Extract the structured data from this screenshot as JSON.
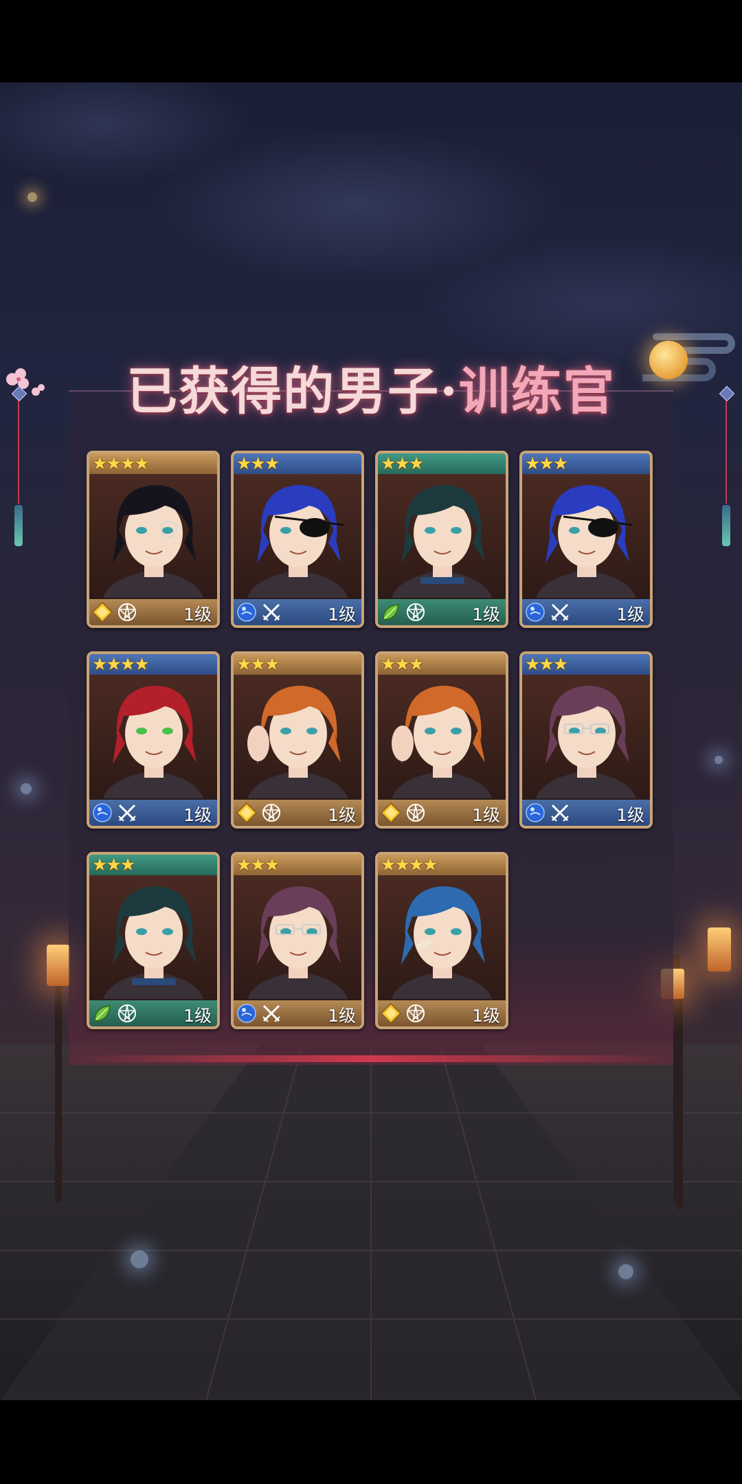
{
  "title": {
    "main": "已获得的男子",
    "separator": "·",
    "accent": "训练官"
  },
  "colors": {
    "frame": "#c9a478",
    "star": "#ffd84a",
    "bar_gold": "#c89a5c",
    "bar_blue": "#4e76b6",
    "bar_green": "#3f9a84"
  },
  "cards": [
    {
      "stars": "★★★★",
      "star_bar": "gold",
      "attribute": "gold-diamond-icon",
      "type": "pentagram-icon",
      "level": "1级",
      "hair": "#15141c",
      "extra": "monocle"
    },
    {
      "stars": "★★★",
      "star_bar": "blue",
      "attribute": "blue-drop-icon",
      "type": "crossed-swords-icon",
      "level": "1级",
      "hair": "#2a3cc0",
      "extra": "eyepatch"
    },
    {
      "stars": "★★★",
      "star_bar": "green",
      "attribute": "green-leaf-icon",
      "type": "pentagram-icon",
      "level": "1级",
      "hair": "#1d3a3e",
      "extra": "choker"
    },
    {
      "stars": "★★★",
      "star_bar": "blue",
      "attribute": "blue-drop-icon",
      "type": "crossed-swords-icon",
      "level": "1级",
      "hair": "#2a3cc0",
      "extra": "eyepatch"
    },
    {
      "stars": "★★★★",
      "star_bar": "blue",
      "attribute": "blue-drop-icon",
      "type": "crossed-swords-icon",
      "level": "1级",
      "hair": "#b3202a",
      "extra": "none"
    },
    {
      "stars": "★★★",
      "star_bar": "gold",
      "attribute": "gold-diamond-icon",
      "type": "pentagram-icon",
      "level": "1级",
      "hair": "#d0692a",
      "extra": "hand"
    },
    {
      "stars": "★★★",
      "star_bar": "gold",
      "attribute": "gold-diamond-icon",
      "type": "pentagram-icon",
      "level": "1级",
      "hair": "#d0692a",
      "extra": "hand"
    },
    {
      "stars": "★★★",
      "star_bar": "blue",
      "attribute": "blue-drop-icon",
      "type": "crossed-swords-icon",
      "level": "1级",
      "hair": "#6a3e58",
      "extra": "glasses"
    },
    {
      "stars": "★★★",
      "star_bar": "green",
      "attribute": "green-leaf-icon",
      "type": "pentagram-icon",
      "level": "1级",
      "hair": "#1d3a3e",
      "extra": "choker"
    },
    {
      "stars": "★★★",
      "star_bar": "gold",
      "attribute": "blue-drop-icon",
      "type": "crossed-swords-icon",
      "level": "1级",
      "hair": "#6a3e58",
      "extra": "glasses"
    },
    {
      "stars": "★★★★",
      "star_bar": "gold",
      "attribute": "gold-diamond-icon",
      "type": "pentagram-icon",
      "level": "1级",
      "hair": "#2e6ab0",
      "extra": "bandage"
    }
  ]
}
